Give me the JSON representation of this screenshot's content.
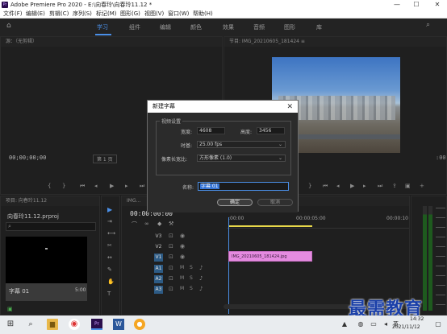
{
  "window": {
    "title": "Adobe Premiere Pro 2020 - E:\\向春玲\\向春玲11.12 *",
    "minimize": "—",
    "maximize": "☐",
    "close": "✕"
  },
  "menu": [
    "文件(F)",
    "编辑(E)",
    "剪辑(C)",
    "序列(S)",
    "标记(M)",
    "图形(G)",
    "视图(V)",
    "窗口(W)",
    "帮助(H)"
  ],
  "workspace": {
    "home_icon": "home-icon",
    "tabs": [
      "学习",
      "组件",
      "编辑",
      "颜色",
      "效果",
      "音频",
      "图形",
      "库"
    ],
    "active": "学习"
  },
  "source_panel": {
    "header": "源：（无剪辑）",
    "timecode": "00;00;00;00",
    "page": "第 1 页"
  },
  "program_panel": {
    "header": "节目: IMG_20210605_181424 ≡",
    "bottom_timecode": ":00:00",
    "scale": "00"
  },
  "project_panel": {
    "tabs": "项目: 向春玲11.12",
    "project_name": "向春玲11.12.prproj",
    "clip_name": "字幕 01",
    "clip_duration": "5:00"
  },
  "timeline": {
    "header": "IMG...",
    "timecode": "00:00:00:00",
    "ruler": [
      ":00:00",
      "00:00:05:00",
      "00:00:10"
    ],
    "tracks": [
      {
        "name": "V3",
        "on": false
      },
      {
        "name": "V2",
        "on": false
      },
      {
        "name": "V1",
        "on": true
      },
      {
        "name": "A1",
        "on": true
      },
      {
        "name": "A2",
        "on": true
      },
      {
        "name": "A3",
        "on": true
      }
    ],
    "clip_label": "IMG_20210605_181424.jpg"
  },
  "dialog": {
    "title": "新建字幕",
    "close": "✕",
    "group_legend": "视频设置",
    "width_label": "宽度:",
    "width_value": "4608",
    "height_label": "高度:",
    "height_value": "3456",
    "timebase_label": "时基:",
    "timebase_value": "25.00 fps",
    "par_label": "像素长宽比:",
    "par_value": "方形像素 (1.0)",
    "name_label": "名称:",
    "name_value": "字幕 01",
    "ok_label": "确定",
    "cancel_label": "取消"
  },
  "taskbar": {
    "time": "14:32",
    "date": "2021/11/12",
    "lang": "英"
  },
  "watermark": "最需教育",
  "colors": {
    "accent": "#4a8fe7",
    "clip": "#e58be0",
    "playhead": "#4a8fe7"
  }
}
